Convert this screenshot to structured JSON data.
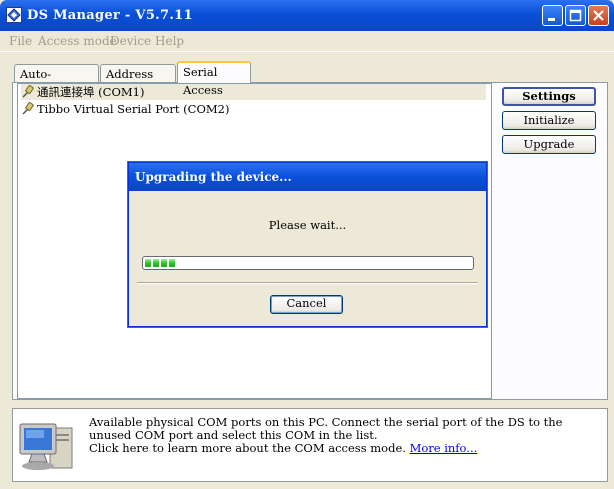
{
  "window": {
    "title": "DS Manager - V5.7.11",
    "controls": {
      "minimize_icon": "minimize-icon",
      "maximize_icon": "maximize-icon",
      "close_icon": "close-icon"
    }
  },
  "menu": {
    "file": "File",
    "access_mode": "Access mode",
    "device": "Device",
    "help": "Help"
  },
  "tabs": [
    {
      "label": "Auto-Discovery",
      "active": false
    },
    {
      "label": "Address Book",
      "active": false
    },
    {
      "label": "Serial Access",
      "active": true
    }
  ],
  "ports": [
    {
      "label": "通訊連接埠 (COM1)",
      "selected": true
    },
    {
      "label": "Tibbo Virtual Serial Port (COM2)",
      "selected": false
    }
  ],
  "side_buttons": {
    "settings": "Settings",
    "initialize": "Initialize",
    "upgrade": "Upgrade"
  },
  "dialog": {
    "title": "Upgrading the device...",
    "message": "Please wait...",
    "progress_blocks": 4,
    "cancel": "Cancel"
  },
  "info": {
    "line1": "Available physical COM ports on this PC. Connect the serial port of the DS to the unused COM port and select this COM in the list.",
    "line2": "Click here to learn more about the COM access mode.",
    "link": "More info..."
  },
  "colors": {
    "title_bar": "#0A50D8",
    "window_face": "#ECE9D8",
    "progress": "#2BC52B",
    "link": "#0000EE"
  }
}
